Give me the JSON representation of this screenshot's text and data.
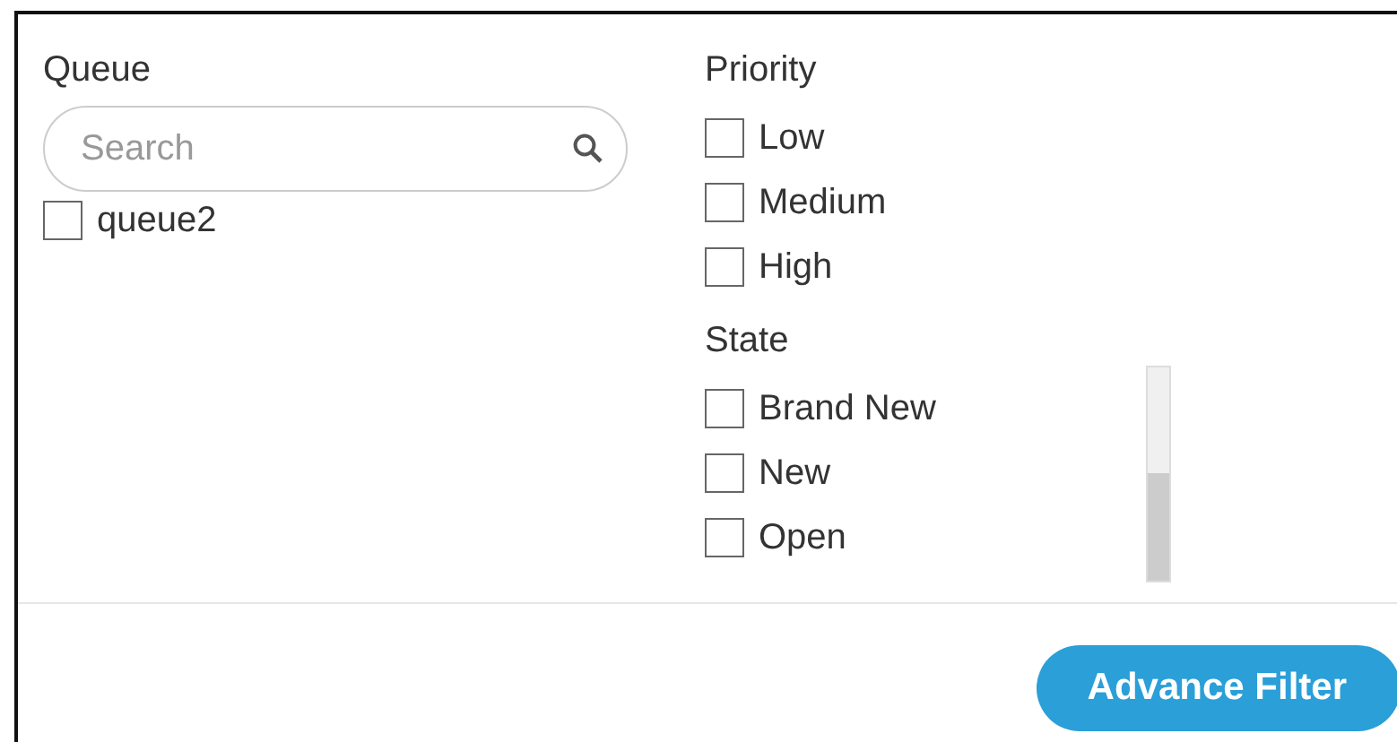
{
  "queue": {
    "title": "Queue",
    "search": {
      "placeholder": "Search"
    },
    "items": [
      {
        "label": "queue2",
        "checked": false
      }
    ]
  },
  "priority": {
    "title": "Priority",
    "items": [
      {
        "label": "Low",
        "checked": false
      },
      {
        "label": "Medium",
        "checked": false
      },
      {
        "label": "High",
        "checked": false
      }
    ]
  },
  "state": {
    "title": "State",
    "items": [
      {
        "label": "Brand New",
        "checked": false
      },
      {
        "label": "New",
        "checked": false
      },
      {
        "label": "Open",
        "checked": false
      }
    ]
  },
  "buttons": [
    {
      "label": "Advance Filter"
    }
  ]
}
